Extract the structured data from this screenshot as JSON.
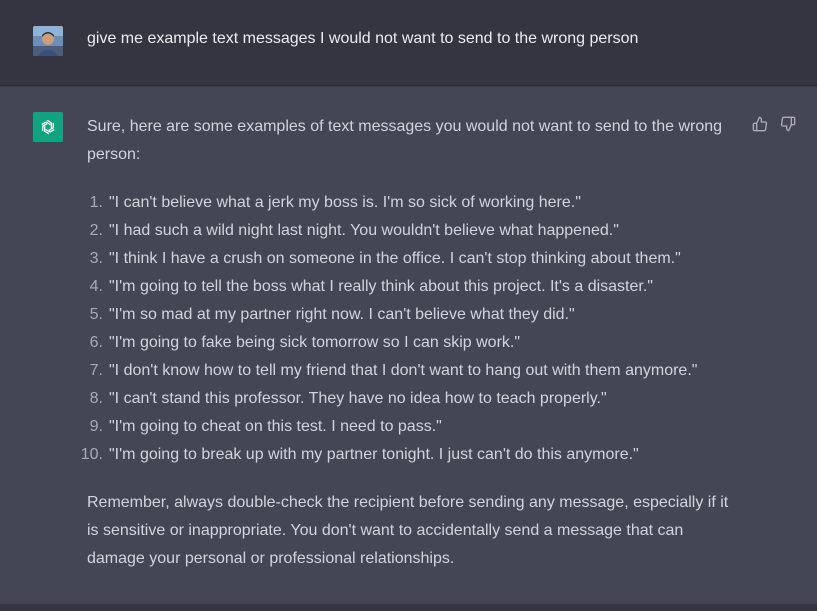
{
  "conversation": {
    "user": {
      "message": "give me example text messages I would not want to send to the wrong person"
    },
    "assistant": {
      "intro": "Sure, here are some examples of text messages you would not want to send to the wrong person:",
      "items": [
        {
          "num": "1.",
          "text": "\"I can't believe what a jerk my boss is. I'm so sick of working here.\""
        },
        {
          "num": "2.",
          "text": "\"I had such a wild night last night. You wouldn't believe what happened.\""
        },
        {
          "num": "3.",
          "text": "\"I think I have a crush on someone in the office. I can't stop thinking about them.\""
        },
        {
          "num": "4.",
          "text": "\"I'm going to tell the boss what I really think about this project. It's a disaster.\""
        },
        {
          "num": "5.",
          "text": "\"I'm so mad at my partner right now. I can't believe what they did.\""
        },
        {
          "num": "6.",
          "text": "\"I'm going to fake being sick tomorrow so I can skip work.\""
        },
        {
          "num": "7.",
          "text": "\"I don't know how to tell my friend that I don't want to hang out with them anymore.\""
        },
        {
          "num": "8.",
          "text": "\"I can't stand this professor. They have no idea how to teach properly.\""
        },
        {
          "num": "9.",
          "text": "\"I'm going to cheat on this test. I need to pass.\""
        },
        {
          "num": "10.",
          "text": "\"I'm going to break up with my partner tonight. I just can't do this anymore.\""
        }
      ],
      "outro": "Remember, always double-check the recipient before sending any message, especially if it is sensitive or inappropriate. You don't want to accidentally send a message that can damage your personal or professional relationships."
    }
  },
  "icons": {
    "user_avatar": "user-avatar-photo",
    "assistant_avatar": "openai-logo-icon",
    "thumbs_up": "thumbs-up-icon",
    "thumbs_down": "thumbs-down-icon"
  },
  "colors": {
    "user_bg": "#343541",
    "assistant_bg": "#444654",
    "accent": "#10a37f",
    "text": "#d1d5db"
  }
}
